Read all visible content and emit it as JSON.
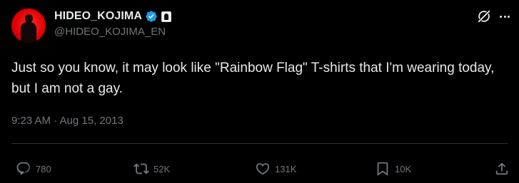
{
  "author": {
    "display_name": "HIDEO_KOJIMA",
    "handle": "@HIDEO_KOJIMA_EN",
    "verified": true,
    "verified_color": "#1d9bf0"
  },
  "header": {
    "grok_icon": "grok-icon",
    "more_icon": "more-horizontal-icon"
  },
  "tweet": {
    "text": "Just so you know, it may look like \"Rainbow Flag\" T-shirts that I'm wearing today, but I am not a gay.",
    "timestamp": "9:23 AM · Aug 15, 2013"
  },
  "actions": {
    "replies": {
      "icon": "reply-icon",
      "count": "780"
    },
    "reposts": {
      "icon": "repost-icon",
      "count": "52K"
    },
    "likes": {
      "icon": "heart-icon",
      "count": "131K"
    },
    "bookmarks": {
      "icon": "bookmark-icon",
      "count": "10K"
    },
    "share": {
      "icon": "share-icon"
    }
  },
  "colors": {
    "background": "#000000",
    "primary_text": "#e7e9ea",
    "secondary_text": "#71767b",
    "divider": "#2f3336",
    "avatar_accent": "#e10000"
  }
}
